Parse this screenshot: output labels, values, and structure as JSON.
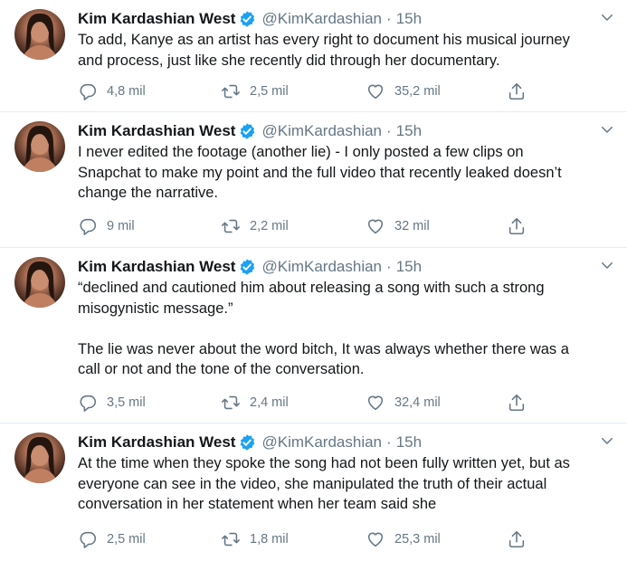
{
  "tweets": [
    {
      "name": "Kim Kardashian West",
      "handle": "@KimKardashian",
      "separator": "·",
      "time": "15h",
      "text": "To add, Kanye as an artist has every right to document his musical journey\nand process, just like she recently did through her documentary.",
      "replies": "4,8 mil",
      "retweets": "2,5 mil",
      "likes": "35,2 mil"
    },
    {
      "name": "Kim Kardashian West",
      "handle": "@KimKardashian",
      "separator": "·",
      "time": "15h",
      "text": "I never edited the footage (another lie) - I only posted a few clips on\nSnapchat to make my point and the full video that recently leaked doesn’t\nchange the narrative.",
      "replies": "9 mil",
      "retweets": "2,2 mil",
      "likes": "32 mil"
    },
    {
      "name": "Kim Kardashian West",
      "handle": "@KimKardashian",
      "separator": "·",
      "time": "15h",
      "text": "“declined and cautioned him about releasing a song with such a strong\nmisogynistic message.”\n\nThe lie was never about the word bitch, It was always whether there was a\ncall or not and the tone of the conversation.",
      "replies": "3,5 mil",
      "retweets": "2,4 mil",
      "likes": "32,4 mil"
    },
    {
      "name": "Kim Kardashian West",
      "handle": "@KimKardashian",
      "separator": "·",
      "time": "15h",
      "text": "At the time when they spoke the song had not been fully written yet, but as\neveryone can see in the video, she manipulated the truth of their actual\nconversation in her statement when her team said she",
      "replies": "2,5 mil",
      "retweets": "1,8 mil",
      "likes": "25,3 mil"
    }
  ],
  "colors": {
    "verified": "#1da1f2",
    "secondary_text": "#657786",
    "divider": "#e6ecf0"
  },
  "icons": [
    "avatar",
    "verified-badge-icon",
    "chevron-down-icon",
    "reply-icon",
    "retweet-icon",
    "like-icon",
    "share-icon"
  ]
}
